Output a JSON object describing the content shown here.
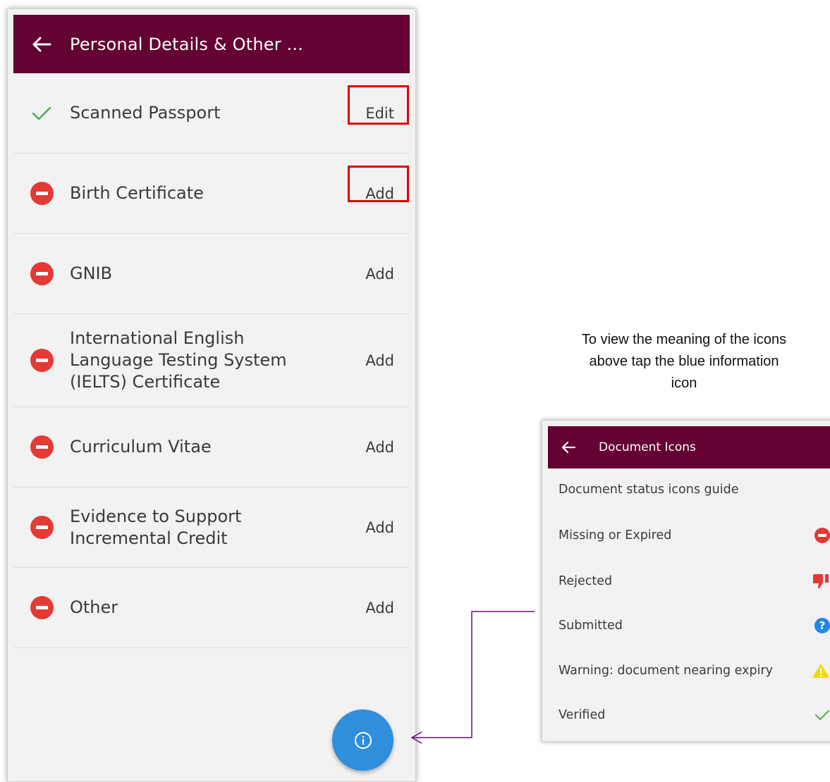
{
  "main": {
    "title": "Personal Details & Other ...",
    "documents": [
      {
        "label": "Scanned Passport",
        "status": "verified",
        "action": "Edit"
      },
      {
        "label": "Birth Certificate",
        "status": "missing",
        "action": "Add"
      },
      {
        "label": "GNIB",
        "status": "missing",
        "action": "Add"
      },
      {
        "label": "International English Language Testing System (IELTS) Certificate",
        "status": "missing",
        "action": "Add"
      },
      {
        "label": "Curriculum Vitae",
        "status": "missing",
        "action": "Add"
      },
      {
        "label": "Evidence to Support Incremental Credit",
        "status": "missing",
        "action": "Add"
      },
      {
        "label": "Other",
        "status": "missing",
        "action": "Add"
      }
    ],
    "fab_icon": "info-icon"
  },
  "caption": "To view the meaning of the icons above tap the blue information icon",
  "icons_panel": {
    "title": "Document Icons",
    "subtitle": "Document status icons guide",
    "items": [
      {
        "label": "Missing or Expired",
        "icon": "minus-circle-icon"
      },
      {
        "label": "Rejected",
        "icon": "thumbs-down-icon"
      },
      {
        "label": "Submitted",
        "icon": "question-circle-icon"
      },
      {
        "label": "Warning: document nearing expiry",
        "icon": "warning-triangle-icon"
      },
      {
        "label": "Verified",
        "icon": "check-icon"
      }
    ]
  },
  "colors": {
    "appbar": "#640032",
    "missing": "#e53935",
    "verified": "#4caf50",
    "fab": "#2f8fdc",
    "highlight": "#e00000",
    "connector": "#6a0c7a"
  }
}
